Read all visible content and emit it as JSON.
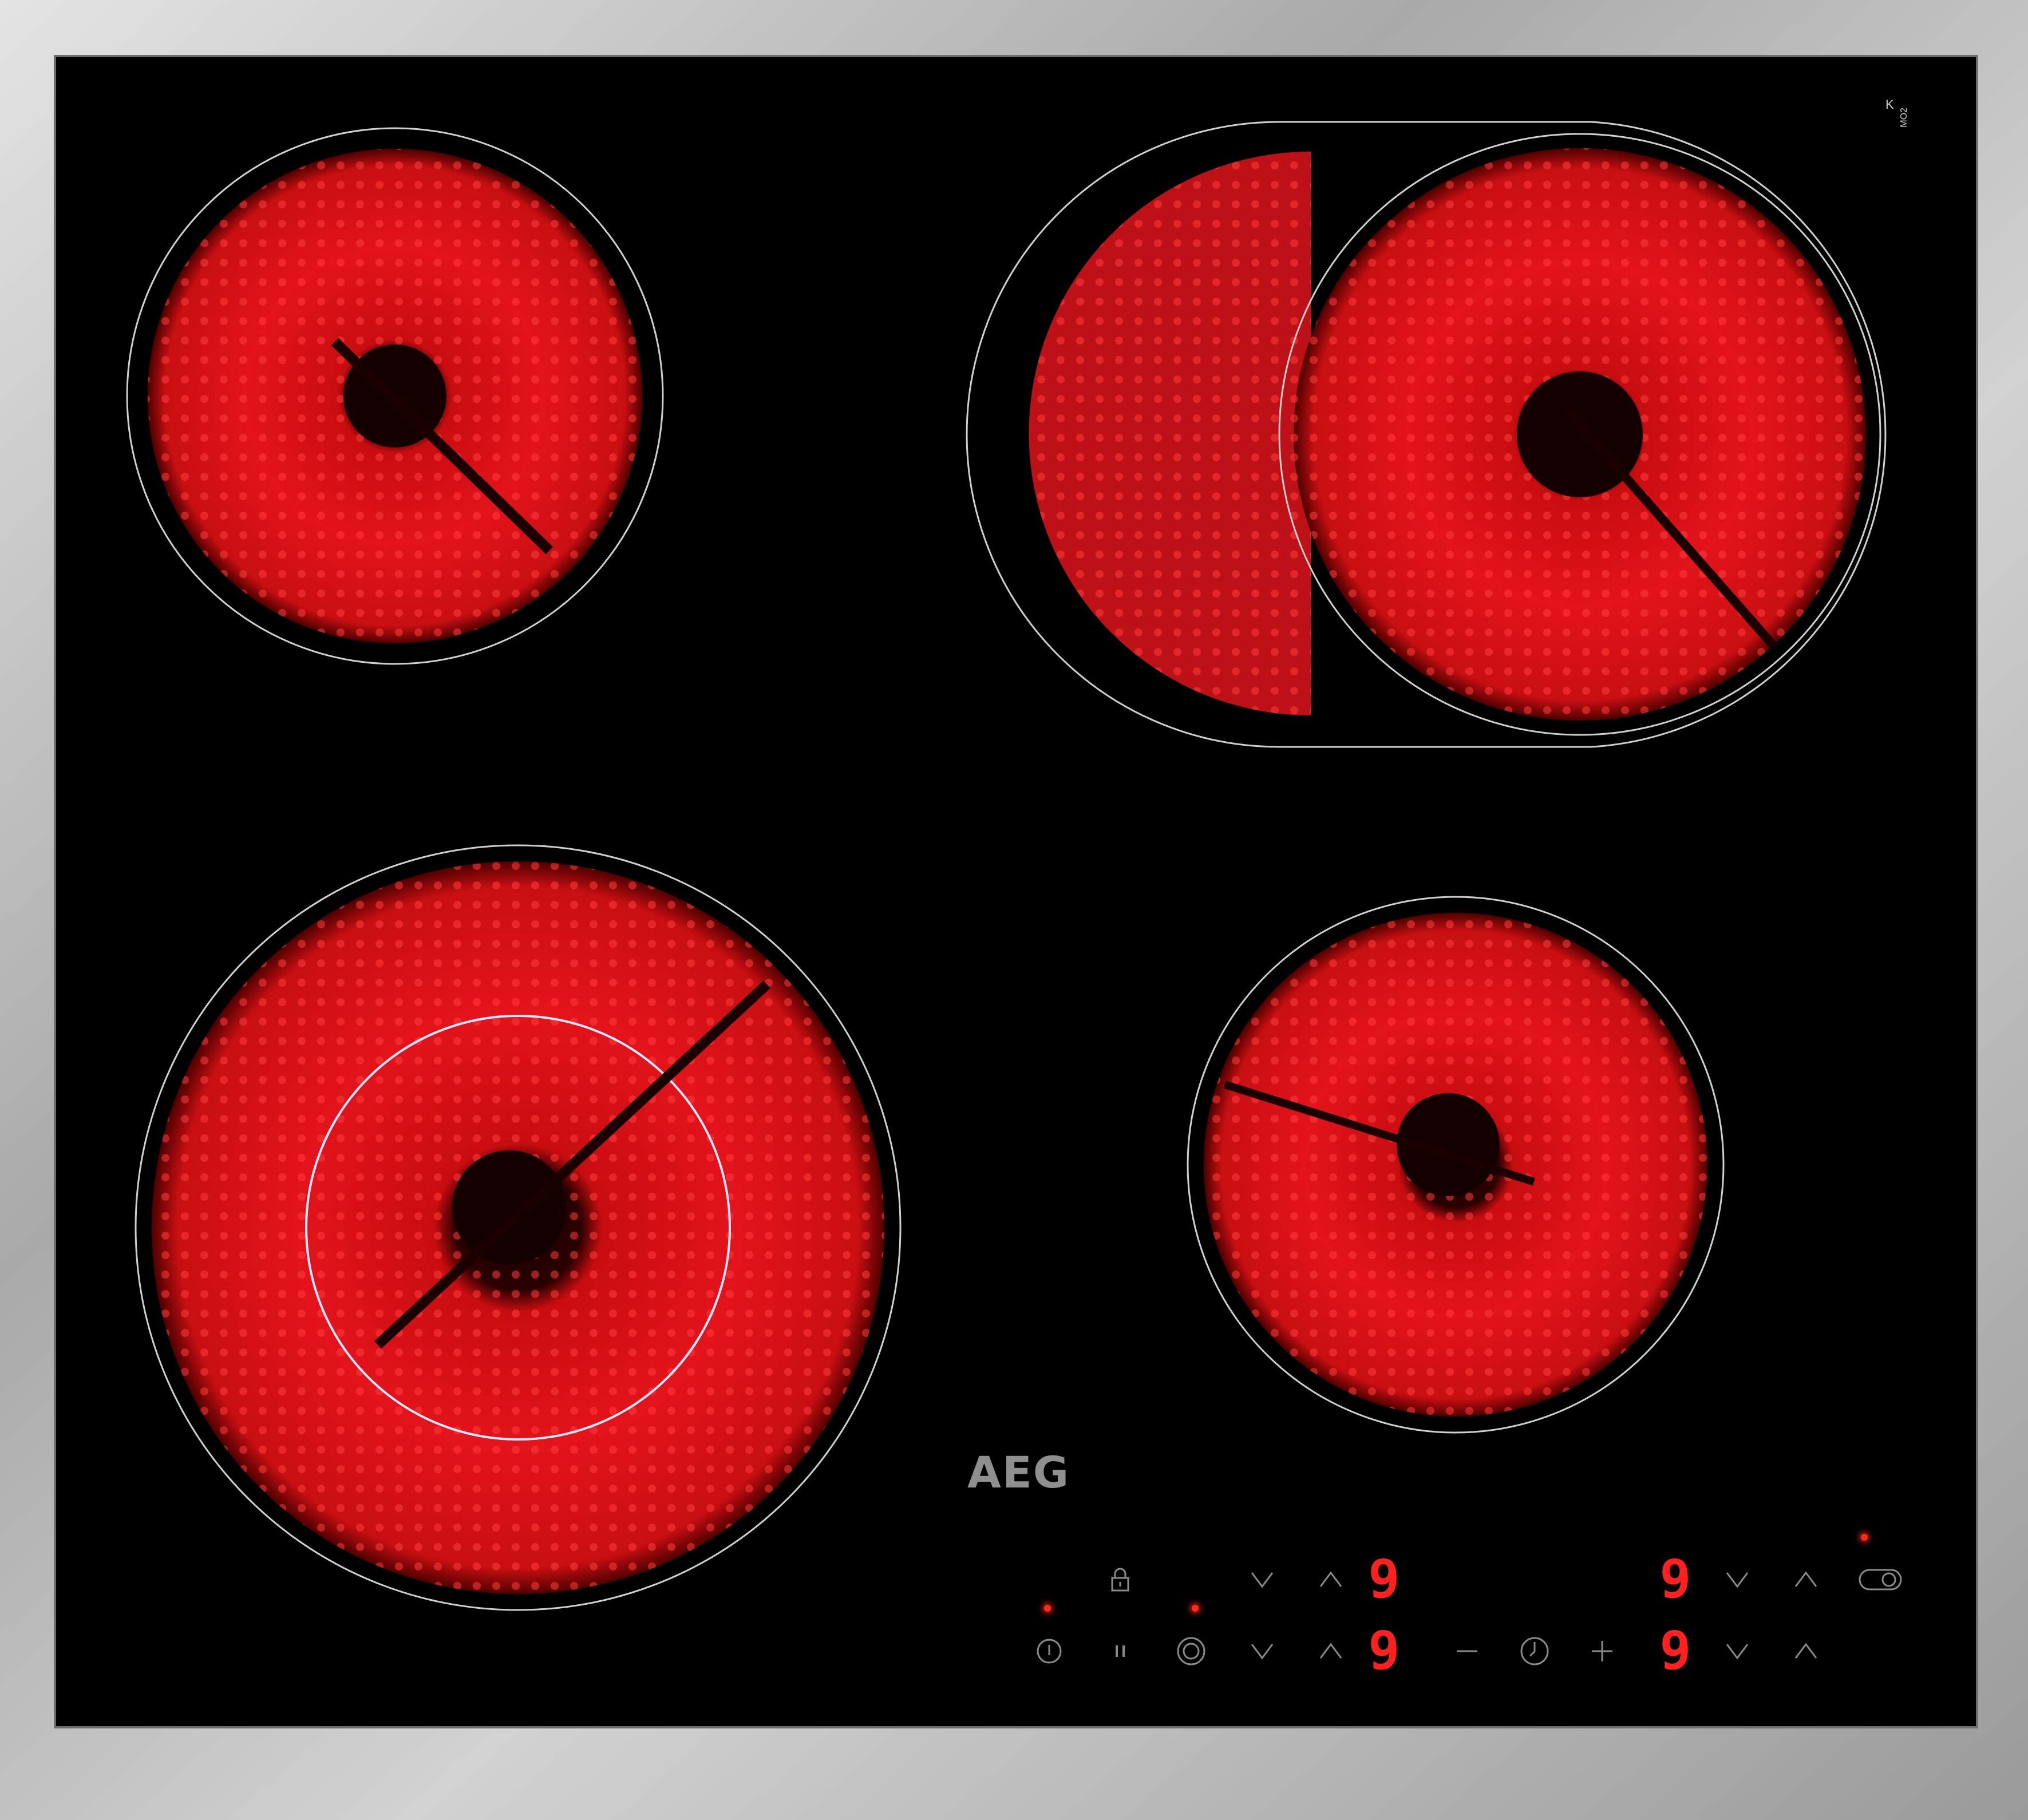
{
  "brand": "AEG",
  "mark_k": "K",
  "mark_code": "MO2",
  "colors": {
    "glow": "#e8141e",
    "glass": "#000000",
    "frame": "#b9b9b9",
    "led": "#ff2020",
    "symbol": "#8a8a8a"
  },
  "displays": {
    "front_left_level": "9",
    "rear_left_level": "9",
    "front_right_level": "9",
    "rear_right_level": "9"
  },
  "controls": {
    "lock": "lock-icon",
    "power": "power-icon",
    "pause": "pause-icon",
    "bridge": "bridge-zone-icon",
    "timer_minus": "−",
    "timer": "clock-icon",
    "timer_plus": "+",
    "dual_zone": "dual-zone-icon",
    "down": "chevron-down-icon",
    "up": "chevron-up-icon"
  }
}
